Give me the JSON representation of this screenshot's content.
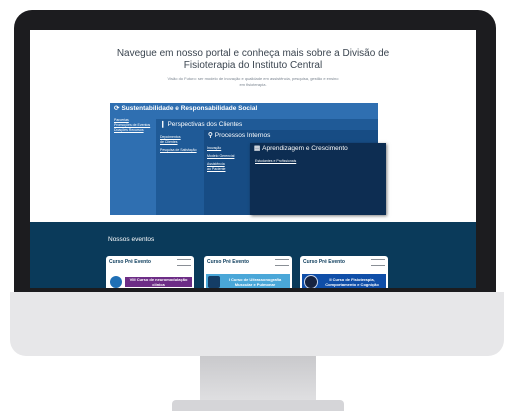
{
  "hero": {
    "title_line1": "Navegue em nosso portal e conheça mais sobre a Divisão de",
    "title_line2": "Fisioterapia do Instituto Central",
    "subtitle_line1": "Visão do Futuro: ser modelo de inovação e qualidade em assistência, pesquisa, gestão e ensino",
    "subtitle_line2": "em fisioterapia."
  },
  "diagram": {
    "sustentabilidade": {
      "icon": "refresh-icon",
      "title": "Sustentabilidade e Responsabilidade Social",
      "links": [
        "Parcerias",
        "Promoções de Eventos",
        "Doações Recursos"
      ]
    },
    "clientes": {
      "icon": "person-icon",
      "title": "Perspectivas dos Clientes",
      "links": [
        "Depoimentos",
        "de Clientes",
        "Pesquisa de Satisfação"
      ]
    },
    "processos": {
      "icon": "lightbulb-icon",
      "title": "Processos Internos",
      "links": [
        "Inovação",
        "Modelo Gerencial",
        "Assistência",
        "ao Paciente"
      ]
    },
    "aprendizagem": {
      "icon": "book-icon",
      "title": "Aprendizagem e Crescimento",
      "links": [
        "Estudantes e Profissionais"
      ]
    }
  },
  "events": {
    "title": "Nossos eventos",
    "cards": [
      {
        "title": "Curso Pré Evento",
        "banner": "VIII Curso de neuromodulação clínica"
      },
      {
        "title": "Curso Pré Evento",
        "banner": "I Curso de Ultrassonografia Muscular e Pulmonar"
      },
      {
        "title": "Curso Pré Evento",
        "banner": "II Curso de Fisioterapia, Comportamento e Cognição"
      }
    ]
  }
}
